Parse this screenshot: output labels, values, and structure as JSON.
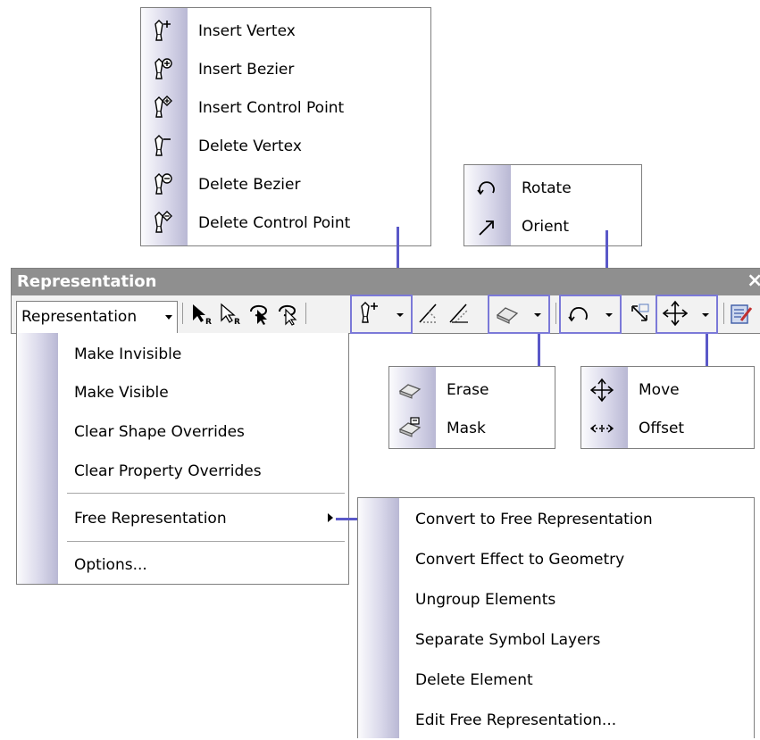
{
  "toolbar": {
    "title": "Representation",
    "close_glyph": "×",
    "menu_label": "Representation",
    "title_bar_color": "#8f8f8f",
    "accent": "#5a58c8"
  },
  "vertex_menu": {
    "items": [
      {
        "label": "Insert Vertex",
        "icon": "insert-vertex-icon"
      },
      {
        "label": "Insert Bezier",
        "icon": "insert-bezier-icon"
      },
      {
        "label": "Insert Control Point",
        "icon": "insert-control-point-icon"
      },
      {
        "label": "Delete Vertex",
        "icon": "delete-vertex-icon"
      },
      {
        "label": "Delete Bezier",
        "icon": "delete-bezier-icon"
      },
      {
        "label": "Delete Control Point",
        "icon": "delete-control-point-icon"
      }
    ]
  },
  "rotate_menu": {
    "items": [
      {
        "label": "Rotate",
        "icon": "rotate-icon"
      },
      {
        "label": "Orient",
        "icon": "orient-icon"
      }
    ]
  },
  "erase_menu": {
    "items": [
      {
        "label": "Erase",
        "icon": "eraser-icon"
      },
      {
        "label": "Mask",
        "icon": "mask-icon"
      }
    ]
  },
  "move_menu": {
    "items": [
      {
        "label": "Move",
        "icon": "move-icon"
      },
      {
        "label": "Offset",
        "icon": "offset-icon"
      }
    ]
  },
  "representation_menu": {
    "items": [
      {
        "label": "Make Invisible"
      },
      {
        "label": "Make Visible"
      },
      {
        "label": "Clear Shape Overrides"
      },
      {
        "label": "Clear Property Overrides"
      },
      {
        "label": "Free Representation"
      },
      {
        "label": "Options..."
      }
    ]
  },
  "free_rep_menu": {
    "items": [
      {
        "label": "Convert to Free Representation"
      },
      {
        "label": "Convert Effect to Geometry"
      },
      {
        "label": "Ungroup Elements"
      },
      {
        "label": "Separate Symbol Layers"
      },
      {
        "label": "Delete Element"
      },
      {
        "label": "Edit Free Representation..."
      }
    ]
  }
}
